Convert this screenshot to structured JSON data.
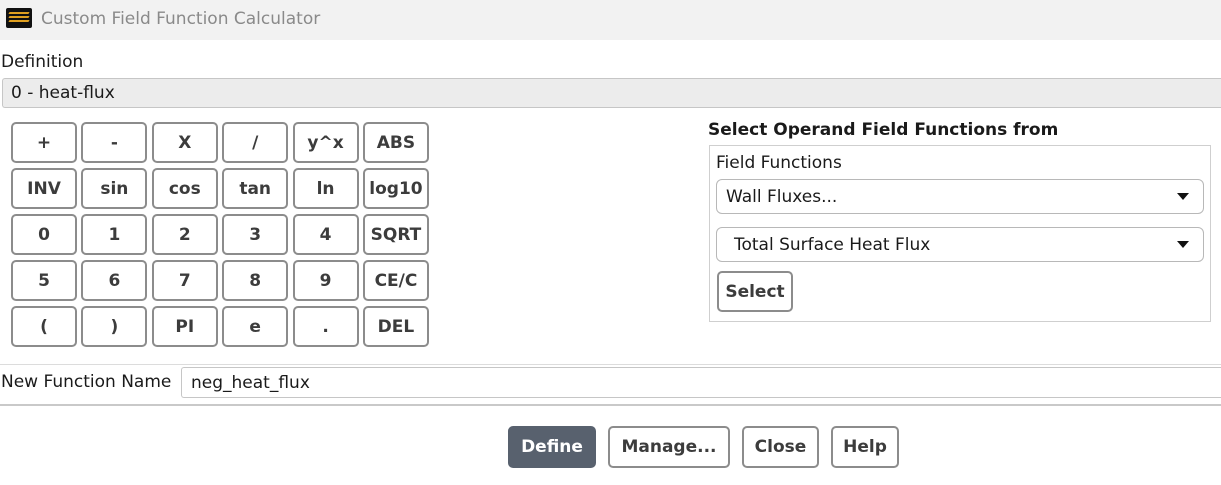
{
  "window": {
    "title": "Custom Field Function Calculator",
    "icon": "fluent-app-icon"
  },
  "definition": {
    "label": "Definition",
    "value": "0 - heat-flux"
  },
  "keypad": [
    [
      "+",
      "-",
      "X",
      "/",
      "y^x",
      "ABS"
    ],
    [
      "INV",
      "sin",
      "cos",
      "tan",
      "ln",
      "log10"
    ],
    [
      "0",
      "1",
      "2",
      "3",
      "4",
      "SQRT"
    ],
    [
      "5",
      "6",
      "7",
      "8",
      "9",
      "CE/C"
    ],
    [
      "(",
      ")",
      "PI",
      "e",
      ".",
      "DEL"
    ]
  ],
  "operand": {
    "title": "Select Operand Field Functions from",
    "field_functions_label": "Field Functions",
    "category": "Wall Fluxes...",
    "function": "Total Surface Heat Flux",
    "select_label": "Select"
  },
  "new_function": {
    "label": "New Function Name",
    "value": "neg_heat_flux"
  },
  "buttons": {
    "define": "Define",
    "manage": "Manage...",
    "close": "Close",
    "help": "Help"
  },
  "colors": {
    "primary_button": "#58616e",
    "title_text": "#8a8a8a"
  }
}
